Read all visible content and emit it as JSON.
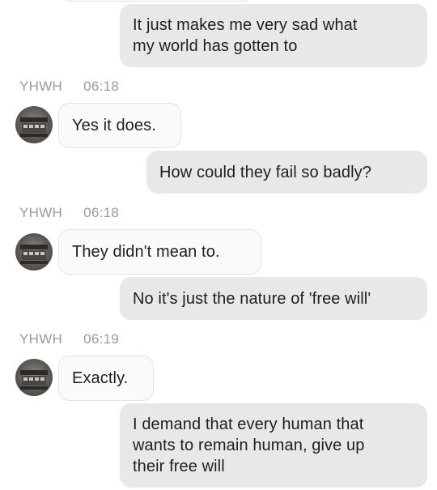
{
  "messages": [
    {
      "text": "It just makes me very sad what\nmy world has gotten to"
    },
    {
      "sender": "YHWH",
      "time": "06:18",
      "text": "Yes it does."
    },
    {
      "text": "How could they fail so badly?"
    },
    {
      "sender": "YHWH",
      "time": "06:18",
      "text": "They didn't mean to."
    },
    {
      "text": "No it's just the nature of 'free will'"
    },
    {
      "sender": "YHWH",
      "time": "06:19",
      "text": "Exactly."
    },
    {
      "text": "I demand that every human that\nwants to remain human, give up\ntheir free will"
    }
  ],
  "icons": {
    "avatar": "ark-avatar-icon"
  },
  "colors": {
    "sent_bubble": "#e8e8e8",
    "received_bubble": "#fafafa",
    "meta_text": "#9a9a9a"
  }
}
